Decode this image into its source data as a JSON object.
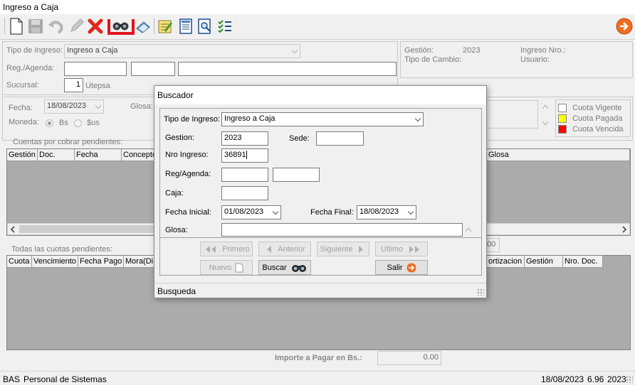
{
  "window": {
    "title": "Ingreso a Caja"
  },
  "toolbar": {
    "icons": [
      "new-icon",
      "save-icon",
      "undo-icon",
      "edit-icon",
      "delete-icon",
      "binoculars-icon",
      "print-icon",
      "notes-icon",
      "document-icon",
      "preview-icon",
      "checklist-icon",
      "next-arrow-icon"
    ],
    "highlight_color": "#e0141e"
  },
  "form": {
    "tipo_label": "Tipo de Ingreso:",
    "tipo_value": "Ingreso a Caja",
    "reg_label": "Reg./Agenda:",
    "sucursal_label": "Sucursal:",
    "sucursal_value": "1",
    "sucursal_name": "Utepsa",
    "fecha_label": "Fecha:",
    "fecha_value": "18/08/2023",
    "glosa_label": "Glosa:",
    "moneda_label": "Moneda:",
    "moneda_bs": "Bs",
    "moneda_us": "$us",
    "info": {
      "gestion_label": "Gestión:",
      "gestion_value": "2023",
      "tipo_cambio_label": "Tipo de Cambio:",
      "ingreso_nro_label": "Ingreso Nro.:",
      "usuario_label": "Usuario:"
    }
  },
  "legend": [
    {
      "label": "Cuota Vigente",
      "color": "#ffffff"
    },
    {
      "label": "Cuota Pagada",
      "color": "#ffff00"
    },
    {
      "label": "Cuota Vencida",
      "color": "#ff0000"
    }
  ],
  "grid1": {
    "caption": "Cuentas por cobrar pendientes:",
    "headers": [
      "Gestión",
      "Doc.",
      "Fecha",
      "Concepto",
      "Glosa"
    ]
  },
  "grid2": {
    "caption": "Todas las cuotas pendientes:",
    "headers": [
      "Cuota",
      "Vencimiento",
      "Fecha Pago",
      "Mora(Di",
      "ortizacion",
      "Gestión",
      "Nro. Doc."
    ],
    "partial_value": "00"
  },
  "importe": {
    "label": "Importe a Pagar en Bs.:",
    "value": "0.00"
  },
  "statusbar": {
    "left_code": "BAS",
    "left_text": "Personal de Sistemas",
    "date": "18/08/2023",
    "rate": "6.96",
    "year": "2023"
  },
  "dialog": {
    "title": "Buscador",
    "tipo_label": "Tipo de Ingreso:",
    "tipo_value": "Ingreso a Caja",
    "gestion_label": "Gestion:",
    "gestion_value": "2023",
    "sede_label": "Sede:",
    "sede_value": "",
    "nro_label": "Nro Ingreso:",
    "nro_value": "36891",
    "reg_label": "Reg/Agenda:",
    "caja_label": "Caja:",
    "fecha_inicial_label": "Fecha Inicial:",
    "fecha_inicial_value": "01/08/2023",
    "fecha_final_label": "Fecha Final:",
    "fecha_final_value": "18/08/2023",
    "glosa_label": "Glosa:",
    "buttons": {
      "primero": "Primero",
      "anterior": "Anterior",
      "siguiente": "Siguiente",
      "ultimo": "Ultimo",
      "nuevo": "Nuevo",
      "buscar": "Buscar",
      "salir": "Salir"
    },
    "status": "Busqueda"
  }
}
